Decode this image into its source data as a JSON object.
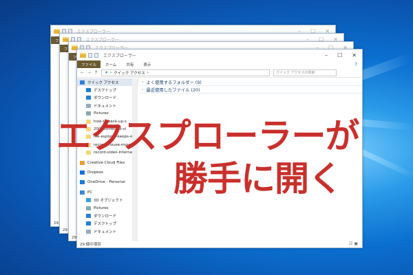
{
  "window": {
    "title": "エクスプローラー",
    "minimize": "–",
    "maximize": "☐",
    "close": "✕"
  },
  "ribbon": {
    "tabs": [
      "ファイル",
      "ホーム",
      "共有",
      "表示"
    ]
  },
  "address": {
    "path": "クイック アクセス",
    "search_placeholder": "クイック アクセスの検索"
  },
  "nav": {
    "items": [
      {
        "label": "クイック アクセス",
        "icon": "star-icon",
        "color": "#2f7fd8"
      },
      {
        "label": "デスクトップ",
        "icon": "desktop-icon",
        "color": "#1f7fd6"
      },
      {
        "label": "ダウンロード",
        "icon": "download-icon",
        "color": "#2b7fd6"
      },
      {
        "label": "ドキュメント",
        "icon": "document-icon",
        "color": "#9ab"
      },
      {
        "label": "Pictures",
        "icon": "pictures-icon",
        "color": "#8aa"
      },
      {
        "label": "how-to-back-up-s",
        "icon": "folder-icon",
        "color": "#f5d67a"
      },
      {
        "label": "200000-record-vi",
        "icon": "folder-icon",
        "color": "#f5d67a"
      },
      {
        "label": "file-explorer-keeps-op",
        "icon": "folder-icon",
        "color": "#f5d67a"
      },
      {
        "label": "record-mouse-movem",
        "icon": "folder-icon",
        "color": "#f5d67a"
      },
      {
        "label": "record-video-interne",
        "icon": "folder-icon",
        "color": "#f5d67a"
      },
      {
        "label": "Creative Cloud Files",
        "icon": "creative-cloud-icon",
        "color": "#e8a030"
      },
      {
        "label": "Dropbox",
        "icon": "dropbox-icon",
        "color": "#1a6fe0"
      },
      {
        "label": "OneDrive - Personal",
        "icon": "onedrive-icon",
        "color": "#1a7ad8"
      },
      {
        "label": "PC",
        "icon": "pc-icon",
        "color": "#3a8ad8"
      },
      {
        "label": "3D オブジェクト",
        "icon": "3d-objects-icon",
        "color": "#3aa0e0"
      },
      {
        "label": "Pictures",
        "icon": "pictures-icon",
        "color": "#8aa"
      },
      {
        "label": "ダウンロード",
        "icon": "download-icon",
        "color": "#2b7fd6"
      },
      {
        "label": "デスクトップ",
        "icon": "desktop-icon",
        "color": "#1f7fd6"
      },
      {
        "label": "ドキュメント",
        "icon": "document-icon",
        "color": "#9ab"
      }
    ]
  },
  "content": {
    "groups": [
      "よく使用するフォルダー (9)",
      "最近使用したファイル (20)"
    ]
  },
  "status": "29 個の項目",
  "overlay": {
    "line1": "エクスプローラーが",
    "line2": "勝手に開く",
    "color": "#c9302c"
  }
}
